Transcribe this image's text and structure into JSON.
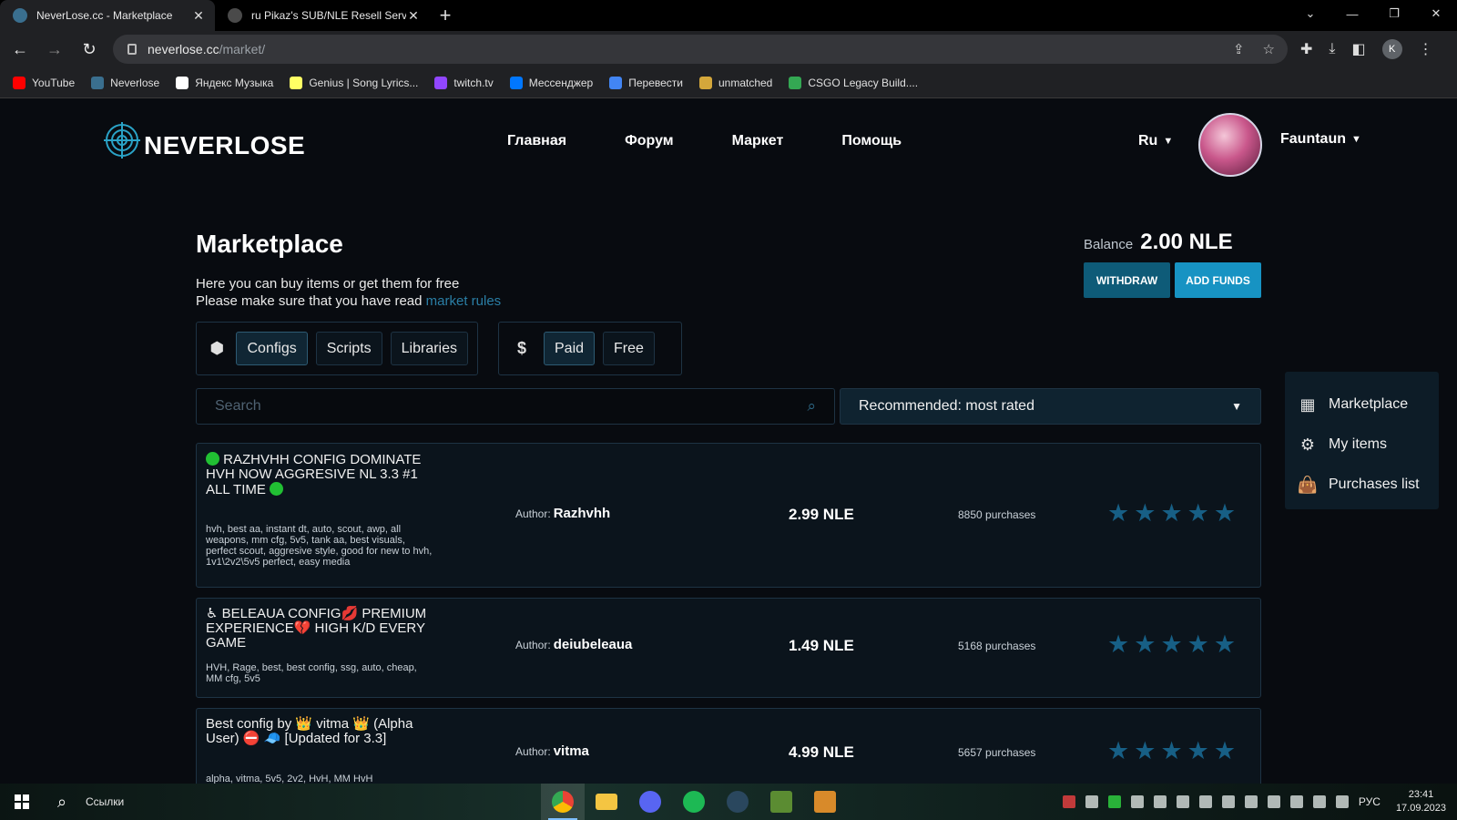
{
  "browser": {
    "tabs": [
      {
        "title": "NeverLose.cc - Marketplace",
        "active": true,
        "favicon_color": "#3a6f8f"
      },
      {
        "title": "ru Pikaz's SUB/NLE Resell Service",
        "active": false,
        "favicon_color": "#4a4a4a"
      }
    ],
    "url_host": "neverlose.cc",
    "url_path": "/market/",
    "profile_initial": "K",
    "bookmarks": [
      {
        "label": "YouTube",
        "color": "#ff0000"
      },
      {
        "label": "Neverlose",
        "color": "#3a6f8f"
      },
      {
        "label": "Яндекс Музыка",
        "color": "#ffffff"
      },
      {
        "label": "Genius | Song Lyrics...",
        "color": "#ffff64"
      },
      {
        "label": "twitch.tv",
        "color": "#9146ff"
      },
      {
        "label": "Мессенджер",
        "color": "#0077ff"
      },
      {
        "label": "Перевести",
        "color": "#4285f4"
      },
      {
        "label": "unmatched",
        "color": "#d4a73b"
      },
      {
        "label": "CSGO Legacy Build....",
        "color": "#34a853"
      }
    ]
  },
  "header": {
    "logo_text": "NEVERLOSE",
    "nav": [
      "Главная",
      "Форум",
      "Маркет",
      "Помощь"
    ],
    "language": "Ru",
    "username": "Fauntaun"
  },
  "market": {
    "title": "Marketplace",
    "desc_line1": "Here you can buy items or get them for free",
    "desc_line2": "Please make sure that you have read",
    "rules_link": "market rules",
    "balance_label": "Balance",
    "balance_value": "2.00 NLE",
    "withdraw_label": "WITHDRAW",
    "add_funds_label": "ADD FUNDS",
    "type_filters": [
      "Configs",
      "Scripts",
      "Libraries"
    ],
    "price_filters": [
      "Paid",
      "Free"
    ],
    "search_placeholder": "Search",
    "sort_label": "Recommended: most rated"
  },
  "items": [
    {
      "title": "RAZHVHH CONFIG DOMINATE HVH NOW AGGRESIVE NL 3.3 #1 ALL TIME",
      "tags": "hvh, best aa, instant dt, auto, scout, awp, all weapons, mm cfg, 5v5, tank aa, best visuals, perfect scout, aggresive style, good for new to hvh, 1v1\\2v2\\5v5 perfect, easy media",
      "author_label": "Author:",
      "author": "Razhvhh",
      "price": "2.99 NLE",
      "purchases": "8850 purchases",
      "rating": 5
    },
    {
      "title": "♿ BELEAUA CONFIG💋 PREMIUM EXPERIENCE💔 HIGH K/D EVERY GAME",
      "tags": "HVH, Rage, best, best config, ssg, auto, cheap, MM cfg, 5v5",
      "author_label": "Author:",
      "author": "deiubeleaua",
      "price": "1.49 NLE",
      "purchases": "5168 purchases",
      "rating": 5
    },
    {
      "title": "Best config by 👑 vitma 👑 (Alpha User) ⛔ 🧢 [Updated for 3.3]",
      "tags": "alpha, vitma, 5v5, 2v2, HvH, MM HvH",
      "author_label": "Author:",
      "author": "vitma",
      "price": "4.99 NLE",
      "purchases": "5657 purchases",
      "rating": 5
    }
  ],
  "sidemenu": [
    {
      "label": "Marketplace",
      "icon": "shop-icon"
    },
    {
      "label": "My items",
      "icon": "gears-icon"
    },
    {
      "label": "Purchases list",
      "icon": "bag-icon"
    }
  ],
  "taskbar": {
    "search_label": "Ссылки",
    "apps": [
      {
        "name": "chrome",
        "color": "#e8453c",
        "active": true
      },
      {
        "name": "explorer",
        "color": "#f4c542",
        "active": false
      },
      {
        "name": "discord",
        "color": "#5865f2",
        "active": false
      },
      {
        "name": "spotify",
        "color": "#1db954",
        "active": false
      },
      {
        "name": "steam",
        "color": "#1b2838",
        "active": false
      },
      {
        "name": "minecraft",
        "color": "#5b8c32",
        "active": false
      },
      {
        "name": "csgo",
        "color": "#d88a2a",
        "active": false
      }
    ],
    "lang": "РУС",
    "time": "23:41",
    "date": "17.09.2023"
  }
}
